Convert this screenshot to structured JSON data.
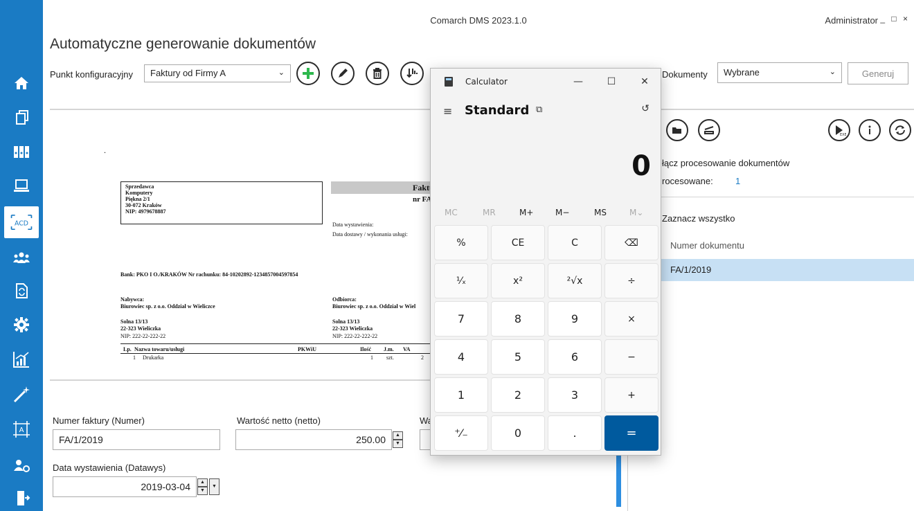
{
  "app": {
    "title": "Comarch DMS 2023.1.0",
    "user": "Administrator",
    "window_controls": "_ □ ×",
    "page_title": "Automatyczne generowanie dokumentów"
  },
  "sidebar": {
    "items": [
      {
        "icon": "home-icon"
      },
      {
        "icon": "documents-icon"
      },
      {
        "icon": "binders-icon"
      },
      {
        "icon": "laptop-icon"
      },
      {
        "icon": "acd-icon",
        "label": "ACD",
        "active": true
      },
      {
        "icon": "users-icon"
      },
      {
        "icon": "document-refresh-icon"
      },
      {
        "icon": "gear-icon"
      },
      {
        "icon": "report-chart-icon"
      },
      {
        "icon": "magic-wand-icon"
      },
      {
        "icon": "frame-a-icon",
        "label": "A"
      },
      {
        "icon": "user-ad-icon"
      },
      {
        "icon": "logout-door-icon"
      }
    ]
  },
  "toolbar": {
    "punkt_label": "Punkt konfiguracyjny",
    "punkt_value": "Faktury od Firmy A",
    "dokumenty_label": "Dokumenty",
    "dokumenty_value": "Wybrane",
    "generate_label": "Generuj"
  },
  "preview": {
    "dot": ".",
    "seller": [
      "Sprzedawca",
      "Komputery",
      "Piękna 2/1",
      "30-072 Kraków",
      "NIP: 4979678887"
    ],
    "invoice_head": "Faktu",
    "invoice_no": "nr FA",
    "data_wyst": "Data wystawienia:",
    "data_dost": "Data dostawy / wykonania usługi:",
    "bank": "Bank: PKO I O./KRAKÓW   Nr rachunku: 84-10202892-1234857004597854",
    "buyer_title": "Nabywca:",
    "buyer_name": "Biurowiec sp. z o.o. Oddział w Wieliczce",
    "buyer_addr1": "Solna 13/13",
    "buyer_addr2": "22-323 Wieliczka",
    "buyer_nip": "NIP: 222-22-222-22",
    "recv_title": "Odbiorca:",
    "recv_name": "Biurowiec sp. z o.o. Oddział w Wiel",
    "recv_addr1": "Solna 13/13",
    "recv_addr2": "22-323 Wieliczka",
    "recv_nip": "NIP: 222-22-222-22",
    "table_headers": [
      "Lp.",
      "Nazwa towaru/usługi",
      "PKWiU",
      "Ilość",
      "J.m.",
      "VA"
    ],
    "row1": [
      "1",
      "Drukarka",
      "1",
      "szt.",
      "2"
    ]
  },
  "right_panel": {
    "processing_label": "łącz procesowanie dokumentów",
    "processed_label": "rocesowane:",
    "processed_count": "1",
    "select_all": "Zaznacz wszystko",
    "column_header": "Numer dokumentu",
    "document_row": "FA/1/2019"
  },
  "form": {
    "invoice_no_label": "Numer faktury (Numer)",
    "invoice_no_value": "FA/1/2019",
    "netto_label": "Wartość netto (netto)",
    "netto_value": "250.00",
    "third_label": "Wa",
    "date_label": "Data wystawienia (Datawys)",
    "date_value": "2019-03-04"
  },
  "calculator": {
    "title": "Calculator",
    "mode": "Standard",
    "display": "0",
    "memory": [
      "MC",
      "MR",
      "M+",
      "M−",
      "MS",
      "M⌄"
    ],
    "memory_disabled": [
      true,
      true,
      false,
      false,
      false,
      true
    ],
    "keys": [
      [
        "%",
        "CE",
        "C",
        "⌫"
      ],
      [
        "¹⁄ₓ",
        "x²",
        "²√x",
        "÷"
      ],
      [
        "7",
        "8",
        "9",
        "×"
      ],
      [
        "4",
        "5",
        "6",
        "−"
      ],
      [
        "1",
        "2",
        "3",
        "+"
      ],
      [
        "⁺⁄₋",
        "0",
        ".",
        "="
      ]
    ],
    "minimize": "—",
    "maximize": "☐",
    "close": "✕"
  },
  "colors": {
    "sidebar": "#1a7bc4",
    "accent_green": "#2db84d",
    "selection": "#c7e0f4",
    "calc_equals": "#005a9e"
  }
}
